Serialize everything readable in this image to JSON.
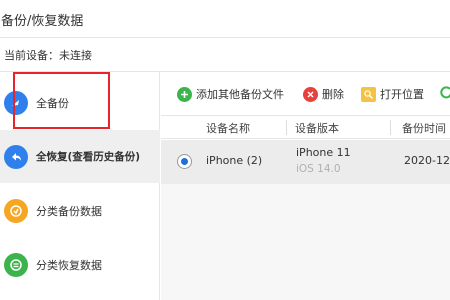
{
  "window": {
    "title": "备份/恢复数据"
  },
  "device": {
    "label": "当前设备：未连接"
  },
  "sidebar": {
    "items": [
      {
        "label": "全备份",
        "icon": "full-backup-icon",
        "color": "#2f80ed"
      },
      {
        "label": "全恢复(查看历史备份)",
        "icon": "restore-icon",
        "color": "#2f80ed"
      },
      {
        "label": "分类备份数据",
        "icon": "category-backup-icon",
        "color": "#f5a623"
      },
      {
        "label": "分类恢复数据",
        "icon": "category-restore-icon",
        "color": "#3cb44b"
      }
    ]
  },
  "toolbar": {
    "add_label": "添加其他备份文件",
    "delete_label": "删除",
    "open_location_label": "打开位置"
  },
  "table": {
    "columns": [
      "设备名称",
      "设备版本",
      "备份时间"
    ],
    "rows": [
      {
        "device_name": "iPhone (2)",
        "device_model": "iPhone 11",
        "ios_version": "iOS 14.0",
        "backup_time": "2020-12-"
      }
    ]
  },
  "colors": {
    "highlight": "#e8232a",
    "accent": "#2f80ed",
    "selected_row": "#ececec"
  }
}
